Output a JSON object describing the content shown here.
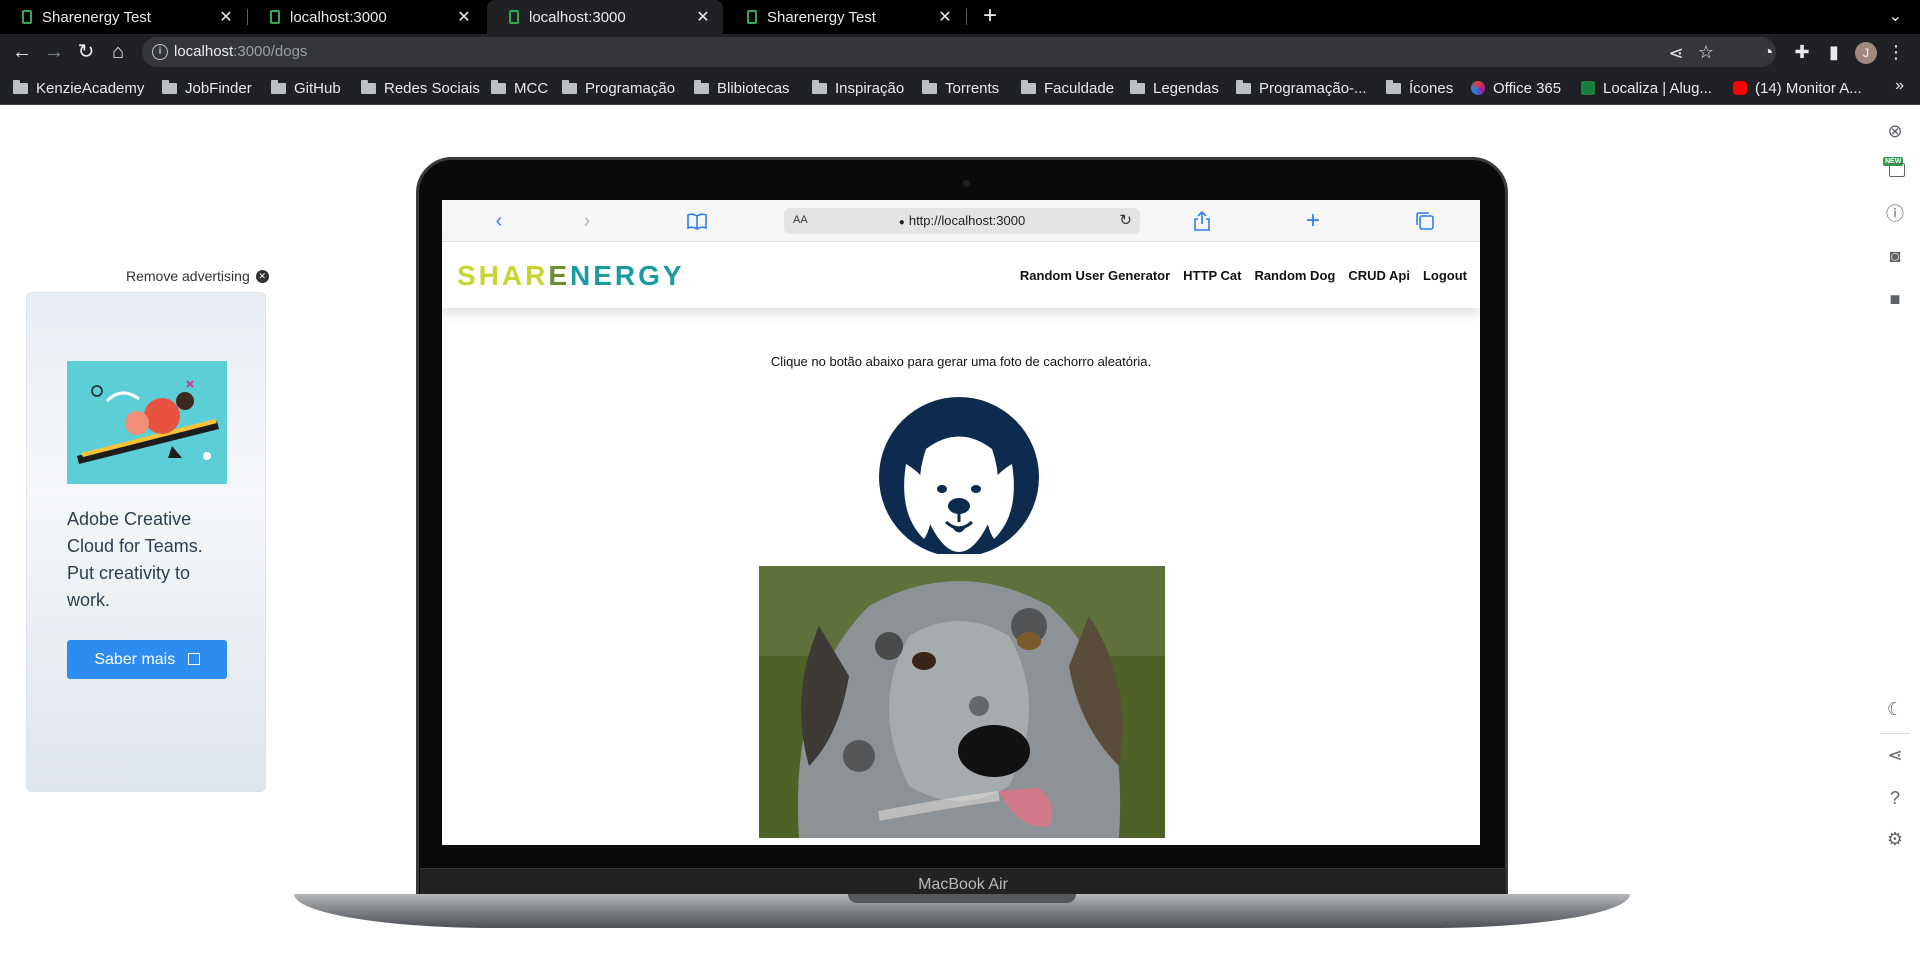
{
  "tabs": [
    {
      "title": "Sharenergy Test",
      "close": "✕"
    },
    {
      "title": "localhost:3000",
      "close": "✕"
    },
    {
      "title": "localhost:3000",
      "close": "✕"
    },
    {
      "title": "Sharenergy Test",
      "close": "✕"
    }
  ],
  "toolbar": {
    "url_host": "localhost",
    "url_path": ":3000/dogs",
    "profile_initial": "J"
  },
  "bookmarks": [
    {
      "label": "KenzieAcademy",
      "type": "folder"
    },
    {
      "label": "JobFinder",
      "type": "folder"
    },
    {
      "label": "GitHub",
      "type": "folder"
    },
    {
      "label": "Redes Sociais",
      "type": "folder"
    },
    {
      "label": "MCC",
      "type": "folder"
    },
    {
      "label": "Programação",
      "type": "folder"
    },
    {
      "label": "Blibiotecas",
      "type": "folder"
    },
    {
      "label": "Inspiração",
      "type": "folder"
    },
    {
      "label": "Torrents",
      "type": "folder"
    },
    {
      "label": "Faculdade",
      "type": "folder"
    },
    {
      "label": "Legendas",
      "type": "folder"
    },
    {
      "label": "Programação-...",
      "type": "folder"
    },
    {
      "label": "Ícones",
      "type": "folder"
    },
    {
      "label": "Office 365",
      "type": "site"
    },
    {
      "label": "Localiza | Alug...",
      "type": "site"
    },
    {
      "label": "(14) Monitor A...",
      "type": "site"
    }
  ],
  "ad": {
    "remove_label": "Remove advertising",
    "text": "Adobe Creative Cloud for Teams. Put creativity to work.",
    "button_label": "Saber mais"
  },
  "device": {
    "label": "MacBook Air"
  },
  "safari": {
    "aa": "AA",
    "url": "http://localhost:3000"
  },
  "site": {
    "logo_part1": "SHAR",
    "logo_part2": "E",
    "logo_part3": "NERGY",
    "nav": [
      "Random User Generator",
      "HTTP Cat",
      "Random Dog",
      "CRUD Api",
      "Logout"
    ],
    "instruction": "Clique no botão abaixo para gerar uma foto de cachorro aleatória."
  },
  "colors": {
    "brand_yellow": "#c6d62e",
    "brand_teal": "#1b9aa0",
    "ad_button": "#2d8cf0",
    "dog_logo": "#0d2a4f"
  },
  "side_panel_badge": "NEW"
}
